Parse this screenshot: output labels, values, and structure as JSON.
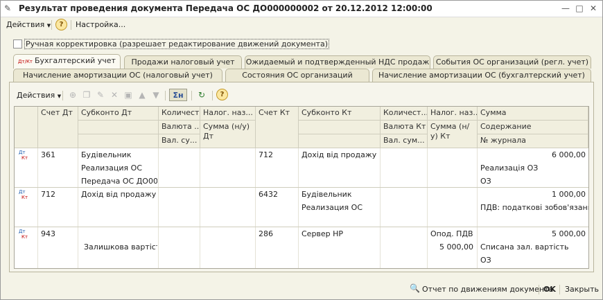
{
  "window": {
    "title": "Результат проведения документа Передача ОС ДО000000002 от 20.12.2012 12:00:00",
    "min_glyph": "—",
    "max_glyph": "□",
    "close_glyph": "✕"
  },
  "menubar": {
    "actions": "Действия",
    "help": "?",
    "settings": "Настройка..."
  },
  "manual_correction": {
    "label": "Ручная корректировка (разрешает редактирование движений документа)",
    "checked": false
  },
  "tabs_row1": [
    {
      "label": "Бухгалтерский учет",
      "active": true
    },
    {
      "label": "Продажи налоговый учет"
    },
    {
      "label": "Ожидаемый и подтвержденный НДС продаж"
    },
    {
      "label": "События ОС организаций (регл. учет)"
    }
  ],
  "tabs_row2": [
    {
      "label": "Начисление амортизации ОС (налоговый учет)"
    },
    {
      "label": "Состояния ОС организаций"
    },
    {
      "label": "Начисление амортизации ОС (бухгалтерский учет)"
    }
  ],
  "toolbar": {
    "actions": "Действия",
    "sum": "Σн",
    "help": "?"
  },
  "columns": {
    "c1": "Счет Дт",
    "c2": "Субконто Дт",
    "c3a": "Количест...",
    "c3b": "Валюта ...",
    "c3c": "Вал. су...",
    "c4a": "Налог. наз...",
    "c4b": "Сумма (н/у) Дт",
    "c5": "Счет Кт",
    "c6": "Субконто Кт",
    "c7a": "Количест...",
    "c7b": "Валюта Кт",
    "c7c": "Вал. сум...",
    "c8a": "Налог. наз...",
    "c8b": "Сумма (н/у) Кт",
    "c9a": "Сумма",
    "c9b": "Содержание",
    "c9c": "№ журнала"
  },
  "rows": [
    {
      "icon_dt": "Дт",
      "icon_kt": "Кт",
      "acc_dt": "361",
      "sub_dt": [
        "Будівельник",
        "Реализация ОС",
        "Передача ОС ДО00..."
      ],
      "acc_kt": "712",
      "sub_kt": [
        "Дохід від продажу н..."
      ],
      "nal_kt": "",
      "sum": "6 000,00",
      "content": "Реализація ОЗ",
      "journal": "ОЗ"
    },
    {
      "icon_dt": "Дт",
      "icon_kt": "Кт",
      "acc_dt": "712",
      "sub_dt": [
        "Дохід від продажу ..."
      ],
      "acc_kt": "6432",
      "sub_kt": [
        "Будівельник",
        "Реализация ОС"
      ],
      "sum": "1 000,00",
      "content": "ПДВ: податкові зобов'язанн..."
    },
    {
      "icon_dt": "Дт",
      "icon_kt": "Кт",
      "acc_dt": "943",
      "sub_dt_line2": "Залишкова вартіст...",
      "acc_kt": "286",
      "sub_kt": [
        "Сервер НР"
      ],
      "nal_kt": "Опод. ПДВ",
      "nal_kt_sum": "5 000,00",
      "sum": "5 000,00",
      "content": "Списана зал. вартість",
      "journal": "ОЗ"
    }
  ],
  "footer": {
    "report": "Отчет по движениям документа",
    "ok": "OK",
    "close": "Закрыть"
  }
}
